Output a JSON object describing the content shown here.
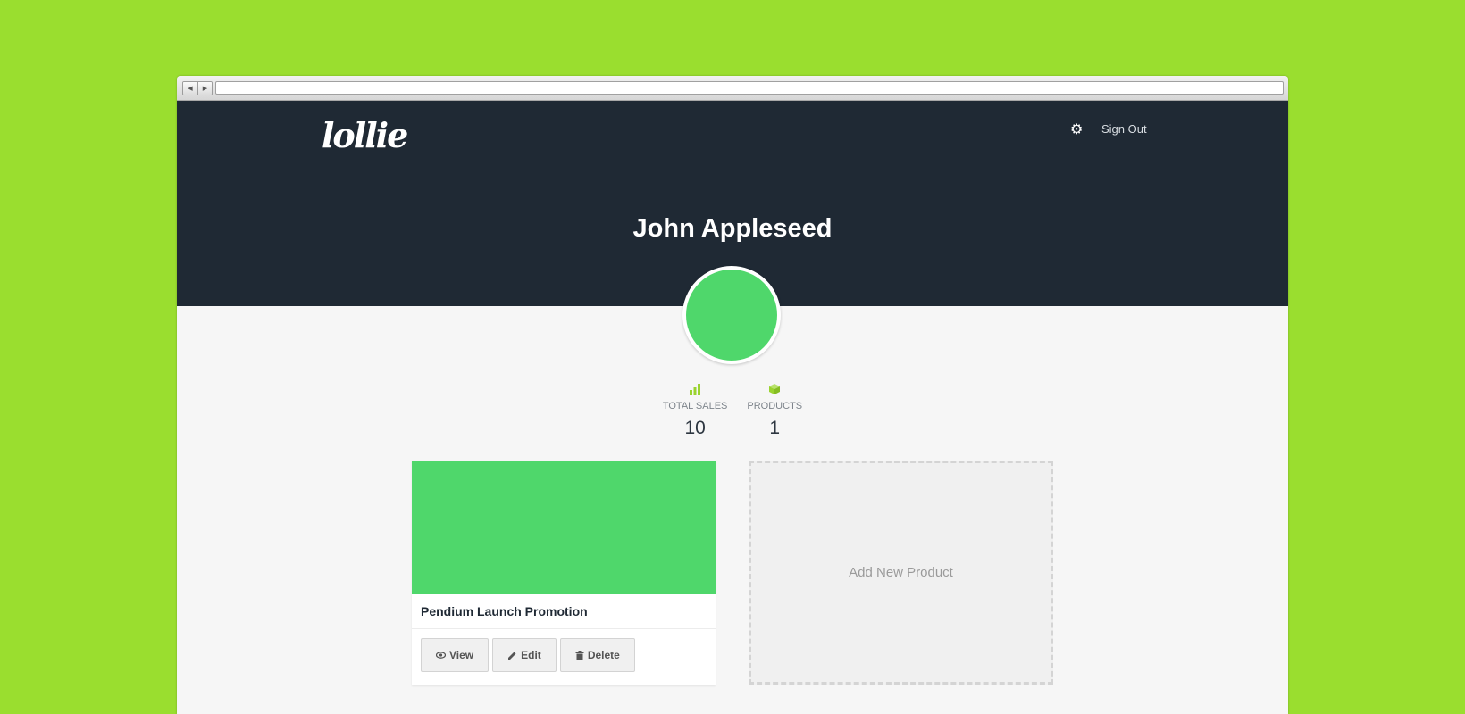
{
  "browser": {
    "back_glyph": "◀",
    "forward_glyph": "▶",
    "url": ""
  },
  "header": {
    "logo": "lollie",
    "settings_icon": "gear-icon",
    "sign_out": "Sign Out"
  },
  "profile": {
    "name": "John Appleseed",
    "avatar_color": "#4fd76b"
  },
  "stats": [
    {
      "icon": "bar-chart-icon",
      "label": "TOTAL SALES",
      "value": "10"
    },
    {
      "icon": "cube-icon",
      "label": "PRODUCTS",
      "value": "1"
    }
  ],
  "products": [
    {
      "title": "Pendium Launch Promotion",
      "image_color": "#4fd76b",
      "actions": {
        "view": "View",
        "edit": "Edit",
        "delete": "Delete"
      }
    }
  ],
  "add_product": {
    "label": "Add New Product"
  },
  "colors": {
    "page_bg": "#9ade2f",
    "header_bg": "#1f2934",
    "accent": "#9ad32f",
    "content_bg": "#f6f6f6"
  }
}
